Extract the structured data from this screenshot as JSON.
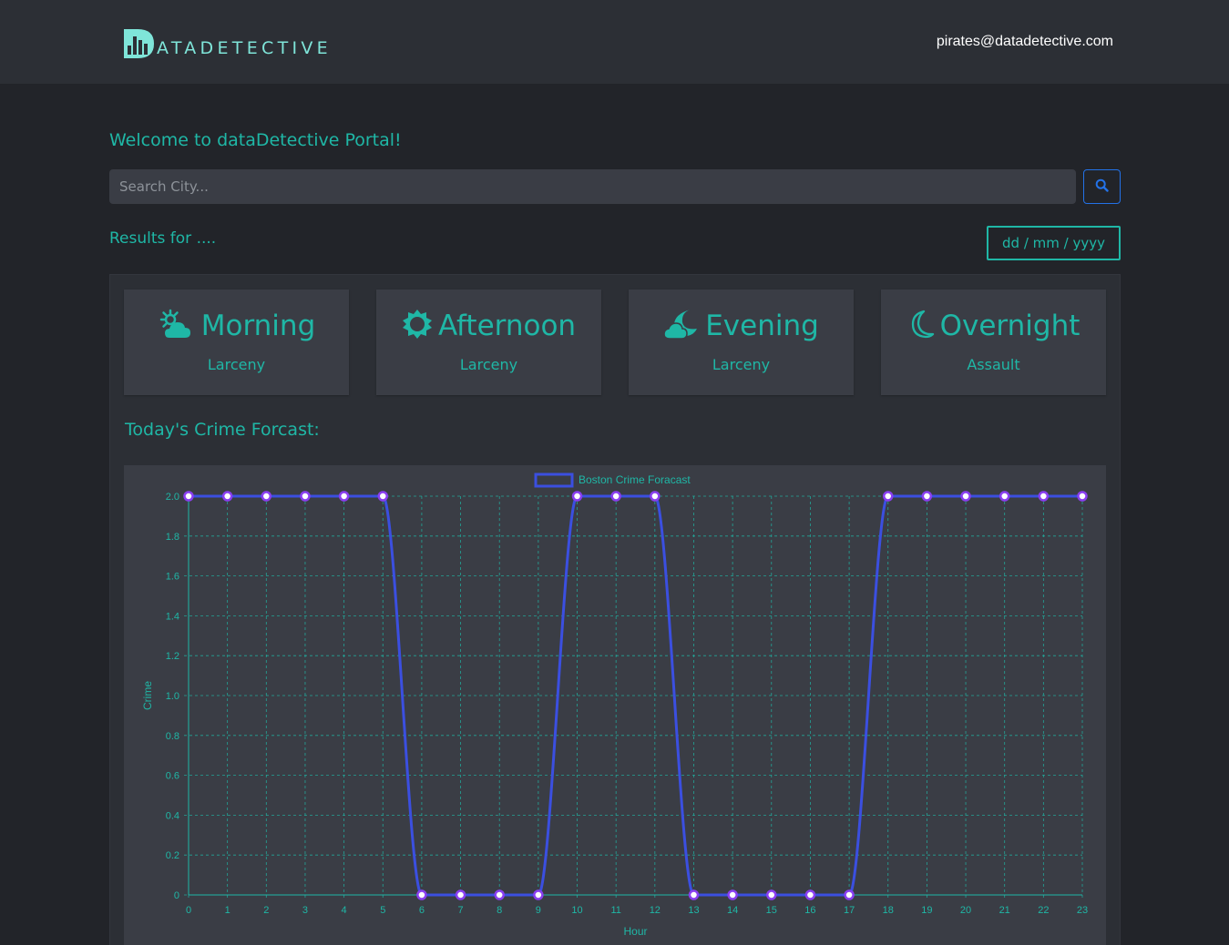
{
  "nav": {
    "logo_text": "ATADETECTIVE",
    "logo_letter": "D",
    "user_email": "pirates@datadetective.com"
  },
  "main": {
    "welcome": "Welcome to dataDetective Portal!",
    "search": {
      "placeholder": "Search City...",
      "value": ""
    },
    "search_button_icon": "search-icon",
    "results_label": "Results for ....",
    "date_placeholder": "dd / mm / yyyy"
  },
  "cards": [
    {
      "title": "Morning",
      "value": "Larceny",
      "icon": "sun-behind-cloud-icon"
    },
    {
      "title": "Afternoon",
      "value": "Larceny",
      "icon": "sun-icon"
    },
    {
      "title": "Evening",
      "value": "Larceny",
      "icon": "moon-cloud-icon"
    },
    {
      "title": "Overnight",
      "value": "Assault",
      "icon": "moon-icon"
    }
  ],
  "forecast_heading": "Today's Crime Forcast:",
  "colors": {
    "accent": "#1fb7a6",
    "line": "#3b4fe0",
    "background": "#222429",
    "card": "#3a3d45",
    "search_button": "#2372e8"
  },
  "chart_data": {
    "type": "line",
    "legend": "Boston Crime Foracast",
    "legend_position": "top-center",
    "xlabel": "Hour",
    "ylabel": "Crime",
    "x": [
      0,
      1,
      2,
      3,
      4,
      5,
      6,
      7,
      8,
      9,
      10,
      11,
      12,
      13,
      14,
      15,
      16,
      17,
      18,
      19,
      20,
      21,
      22,
      23
    ],
    "series": [
      {
        "name": "Boston Crime Foracast",
        "values": [
          2,
          2,
          2,
          2,
          2,
          2,
          0,
          0,
          0,
          0,
          2,
          2,
          2,
          0,
          0,
          0,
          0,
          0,
          2,
          2,
          2,
          2,
          2,
          2
        ]
      }
    ],
    "ylim": [
      0,
      2
    ],
    "yticks": [
      "0",
      "0.2",
      "0.4",
      "0.6",
      "0.8",
      "1.0",
      "1.2",
      "1.4",
      "1.6",
      "1.8",
      "2.0"
    ],
    "grid": true
  }
}
